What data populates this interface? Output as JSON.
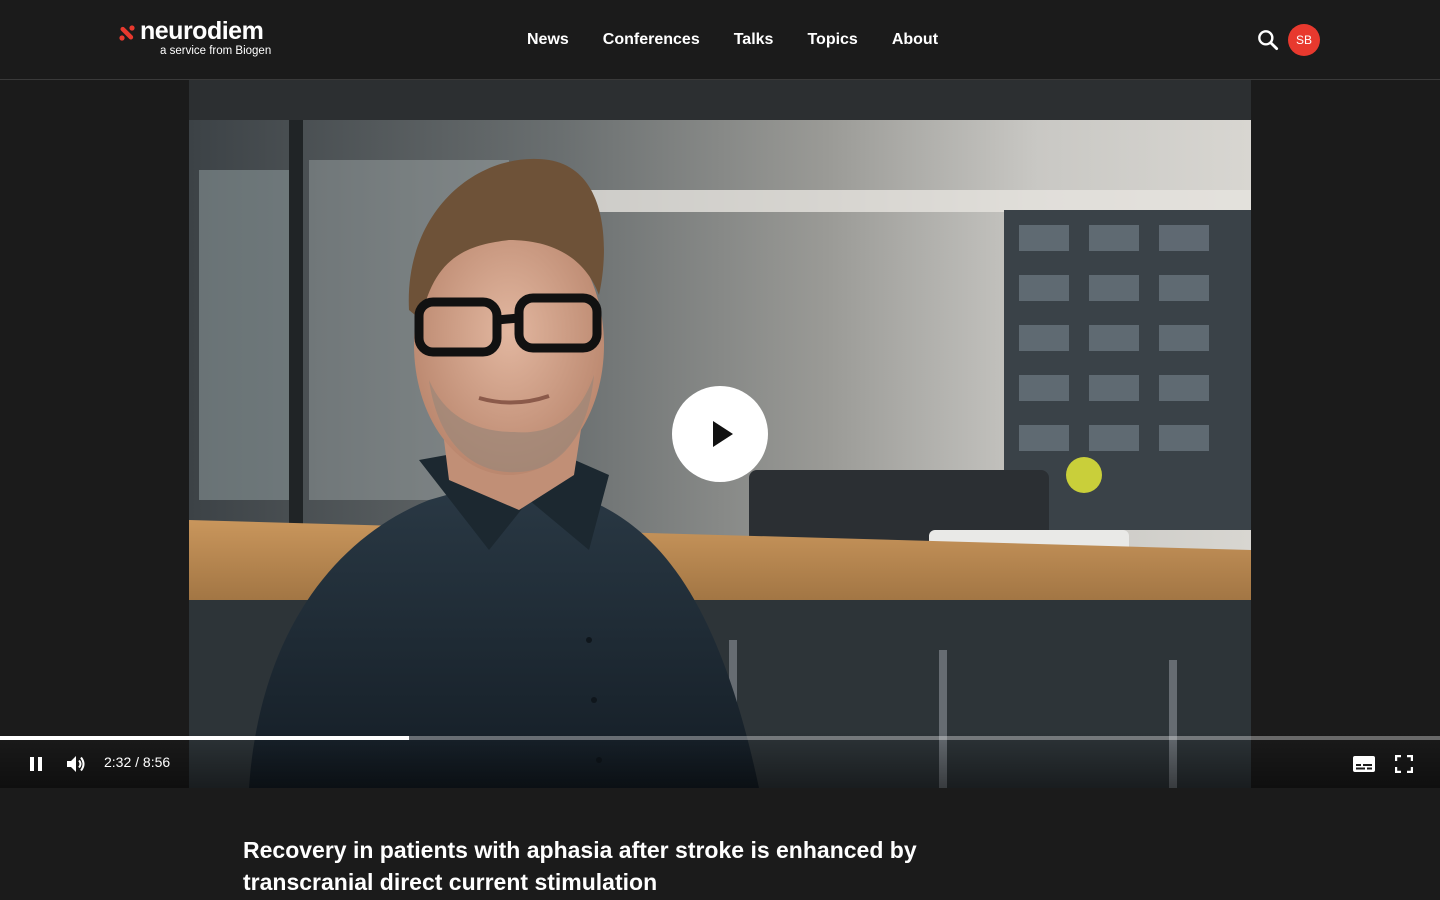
{
  "brand": {
    "name": "neurodiem",
    "tagline": "a service from Biogen",
    "accent_color": "#e8392e"
  },
  "nav": {
    "items": [
      {
        "label": "News"
      },
      {
        "label": "Conferences"
      },
      {
        "label": "Talks"
      },
      {
        "label": "Topics"
      },
      {
        "label": "About"
      }
    ]
  },
  "header": {
    "search_icon": "search-icon",
    "avatar_initials": "SB"
  },
  "player": {
    "state": "paused-overlay",
    "play_icon": "play-icon",
    "pause_icon": "pause-icon",
    "volume_icon": "volume-icon",
    "captions_icon": "captions-icon",
    "fullscreen_icon": "fullscreen-icon",
    "current_time": "2:32",
    "duration": "8:56",
    "time_display": "2:32 / 8:56",
    "progress_fraction": 0.284
  },
  "video": {
    "title": "Recovery in patients with aphasia after stroke is enhanced by transcranial direct current stimulation"
  }
}
